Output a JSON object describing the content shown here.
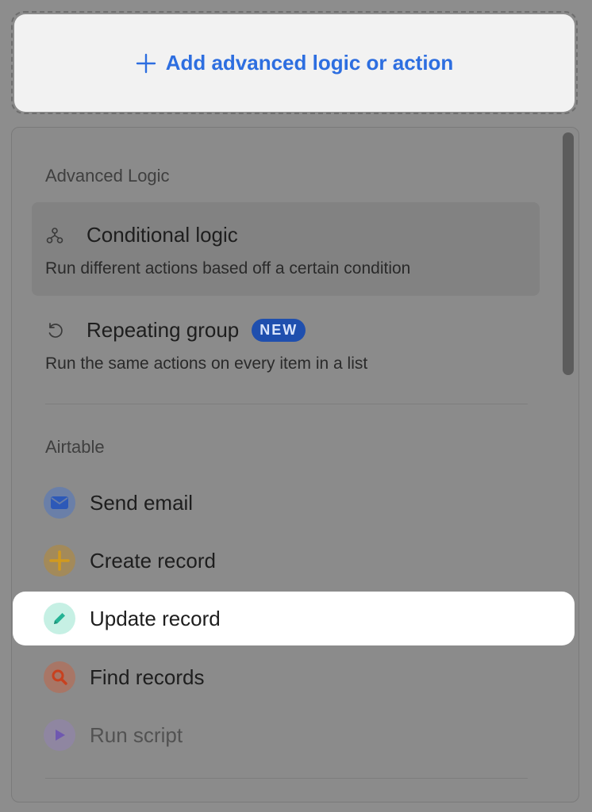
{
  "add_button": {
    "label": "Add advanced logic or action",
    "icon": "plus-icon",
    "color": "#2d6ee0"
  },
  "advanced_logic": {
    "heading": "Advanced Logic",
    "items": [
      {
        "title": "Conditional logic",
        "description": "Run different actions based off a certain condition",
        "icon": "branch-icon"
      },
      {
        "title": "Repeating group",
        "badge": "NEW",
        "description": "Run the same actions on every item in a list",
        "icon": "loop-icon"
      }
    ]
  },
  "airtable": {
    "heading": "Airtable",
    "items": [
      {
        "label": "Send email",
        "icon": "envelope-icon",
        "color": "#2d6ee0"
      },
      {
        "label": "Create record",
        "icon": "plus-icon",
        "color": "#e0a82e"
      },
      {
        "label": "Update record",
        "icon": "pencil-icon",
        "color": "#24b394"
      },
      {
        "label": "Find records",
        "icon": "search-icon",
        "color": "#d9532f"
      },
      {
        "label": "Run script",
        "icon": "play-icon",
        "color": "#8a63d2"
      }
    ]
  }
}
